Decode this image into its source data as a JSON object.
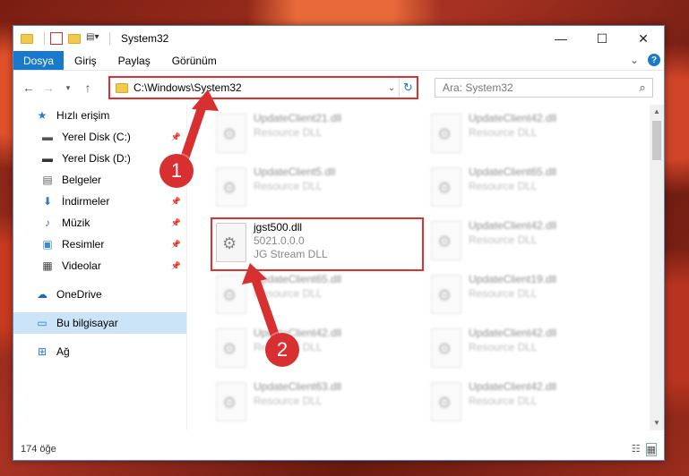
{
  "window": {
    "title": "System32",
    "controls": {
      "minimize": "—",
      "maximize": "☐",
      "close": "✕"
    }
  },
  "ribbon": {
    "file_tab": "Dosya",
    "tabs": [
      "Giriş",
      "Paylaş",
      "Görünüm"
    ],
    "expand": "⌄",
    "help": "?"
  },
  "address": {
    "path": "C:\\Windows\\System32",
    "search_placeholder": "Ara: System32"
  },
  "sidebar": {
    "quick_access": "Hızlı erişim",
    "items": [
      {
        "label": "Yerel Disk (C:)",
        "icon": "drive-icon",
        "pinned": true
      },
      {
        "label": "Yerel Disk (D:)",
        "icon": "drive-icon",
        "pinned": false
      },
      {
        "label": "Belgeler",
        "icon": "documents-icon",
        "pinned": true
      },
      {
        "label": "İndirmeler",
        "icon": "download-icon",
        "pinned": true
      },
      {
        "label": "Müzik",
        "icon": "music-icon",
        "pinned": true
      },
      {
        "label": "Resimler",
        "icon": "pictures-icon",
        "pinned": true
      },
      {
        "label": "Videolar",
        "icon": "videos-icon",
        "pinned": true
      }
    ],
    "onedrive": "OneDrive",
    "this_pc": "Bu bilgisayar",
    "network": "Ağ"
  },
  "files": {
    "col1": [
      {
        "name": "UpdateClient21.dll",
        "sub": "Resource DLL"
      },
      {
        "name": "UpdateClient5.dll",
        "sub": "Resource DLL"
      },
      {
        "name": "jgst500.dll",
        "version": "5021.0.0.0",
        "sub": "JG Stream DLL",
        "highlighted": true
      },
      {
        "name": "UpdateClient65.dll",
        "sub": "Resource DLL"
      },
      {
        "name": "UpdateClient42.dll",
        "sub": "Resource DLL"
      },
      {
        "name": "UpdateClient63.dll",
        "sub": "Resource DLL"
      }
    ],
    "col2": [
      {
        "name": "UpdateClient42.dll",
        "sub": "Resource DLL"
      },
      {
        "name": "UpdateClient65.dll",
        "sub": "Resource DLL"
      },
      {
        "name": "UpdateClient42.dll",
        "sub": "Resource DLL"
      },
      {
        "name": "UpdateClient19.dll",
        "sub": "Resource DLL"
      },
      {
        "name": "UpdateClient42.dll",
        "sub": "Resource DLL"
      },
      {
        "name": "UpdateClient42.dll",
        "sub": "Resource DLL"
      }
    ]
  },
  "status": {
    "count": "174 öğe"
  },
  "callouts": [
    "1",
    "2"
  ],
  "colors": {
    "accent": "#1979ca",
    "highlight": "#e03030",
    "selected": "#cce4f7"
  }
}
